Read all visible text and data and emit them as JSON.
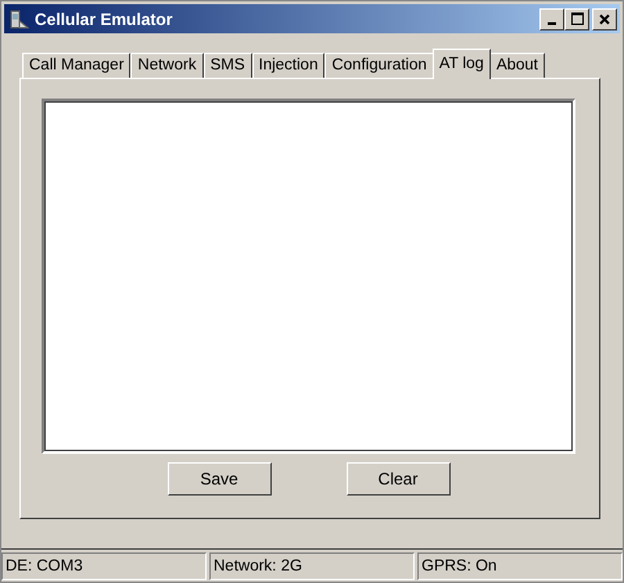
{
  "window": {
    "title": "Cellular Emulator"
  },
  "tabs": [
    {
      "label": "Call Manager",
      "selected": false
    },
    {
      "label": "Network",
      "selected": false
    },
    {
      "label": "SMS",
      "selected": false
    },
    {
      "label": "Injection",
      "selected": false
    },
    {
      "label": "Configuration",
      "selected": false
    },
    {
      "label": "AT log",
      "selected": true
    },
    {
      "label": "About",
      "selected": false
    }
  ],
  "buttons": [
    "Save",
    "Clear"
  ],
  "status_bar": [
    "DE: COM3",
    "Network: 2G",
    "GPRS: On"
  ]
}
